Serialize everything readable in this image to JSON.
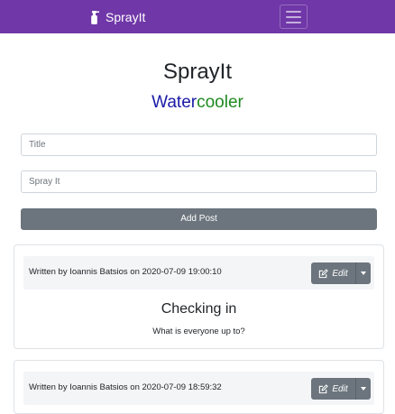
{
  "navbar": {
    "brand": "SprayIt",
    "brand_icon": "spray-bottle-icon",
    "toggler_icon": "hamburger-menu-icon",
    "background": "#6f37a7"
  },
  "header": {
    "title": "SprayIt",
    "subtitle_part1": "Water",
    "subtitle_part2": "cooler",
    "subtitle_color1": "#1a1aa8",
    "subtitle_color2": "#1f8a1f"
  },
  "form": {
    "title_placeholder": "Title",
    "body_placeholder": "Spray It",
    "submit_label": "Add Post"
  },
  "posts": [
    {
      "meta": "Written by Ioannis Batsios on 2020-07-09 19:00:10",
      "edit_label": "Edit",
      "title": "Checking in",
      "body": "What is everyone up to?"
    },
    {
      "meta": "Written by Ioannis Batsios on 2020-07-09 18:59:32",
      "edit_label": "Edit"
    }
  ]
}
